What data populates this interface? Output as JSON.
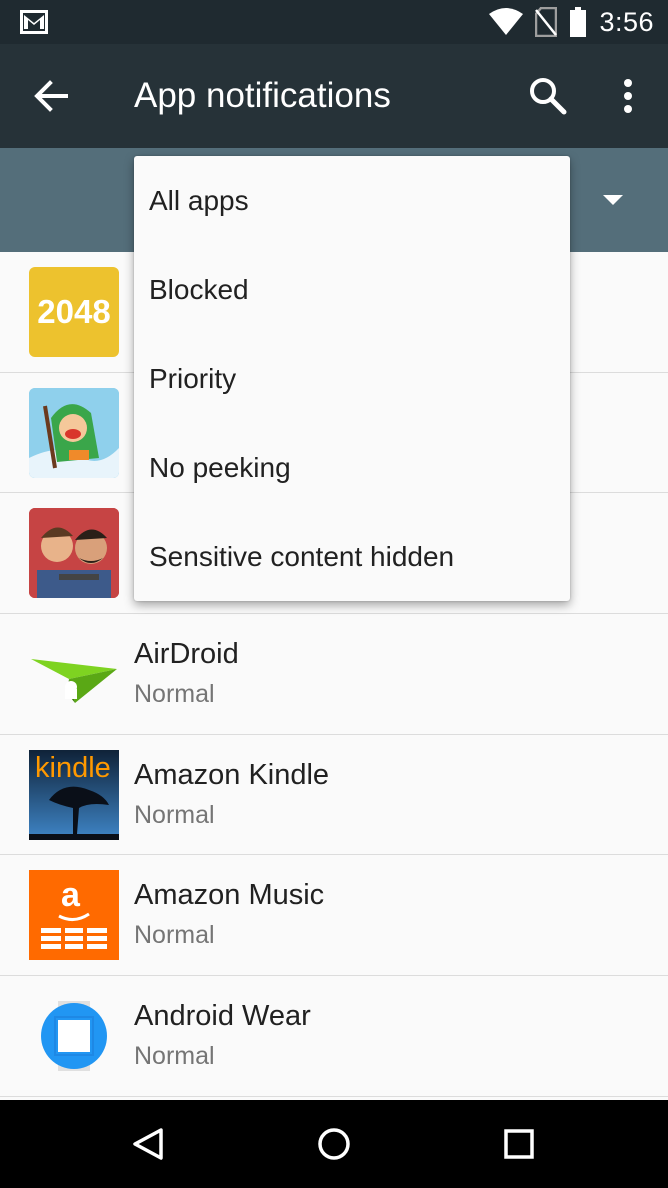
{
  "status_bar": {
    "time": "3:56",
    "icons": [
      "gmail-icon",
      "wifi-icon",
      "no-sim-icon",
      "battery-icon"
    ]
  },
  "toolbar": {
    "title": "App notifications",
    "icons": [
      "back-arrow-icon",
      "search-icon",
      "more-vert-icon"
    ]
  },
  "filter": {
    "dropdown_items": [
      "All apps",
      "Blocked",
      "Priority",
      "No peeking",
      "Sensitive content hidden"
    ]
  },
  "apps": [
    {
      "name": "",
      "status": "",
      "icon_text": "2048",
      "icon": "game-2048-icon"
    },
    {
      "name": "",
      "status": "",
      "icon": "adventure-game-icon"
    },
    {
      "name": "",
      "status": "",
      "icon": "jetpack-joyride-icon"
    },
    {
      "name": "AirDroid",
      "status": "Normal",
      "icon": "airdroid-icon"
    },
    {
      "name": "Amazon Kindle",
      "status": "Normal",
      "icon_text": "kindle",
      "icon": "kindle-icon"
    },
    {
      "name": "Amazon Music",
      "status": "Normal",
      "icon_text": "a",
      "icon": "amazon-music-icon"
    },
    {
      "name": "Android Wear",
      "status": "Normal",
      "icon": "android-wear-icon"
    }
  ],
  "colors": {
    "status_bar": "#1f2a30",
    "toolbar": "#263238",
    "filter_bar": "#546e7a",
    "kindle_orange": "#ff9900",
    "amazon_music_orange": "#ff6a00",
    "wear_blue": "#2196f3"
  },
  "nav_bar": {
    "icons": [
      "back-triangle-icon",
      "home-circle-icon",
      "recents-square-icon"
    ]
  }
}
